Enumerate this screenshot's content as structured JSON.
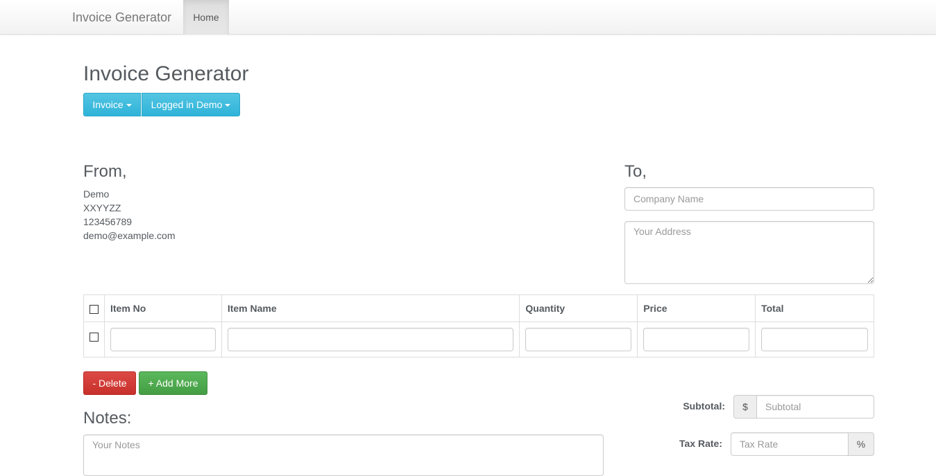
{
  "navbar": {
    "brand": "Invoice Generator",
    "home_label": "Home"
  },
  "page": {
    "title": "Invoice Generator"
  },
  "toolbar": {
    "invoice_label": "Invoice",
    "user_label": "Logged in Demo"
  },
  "from": {
    "heading": "From,",
    "name": "Demo",
    "address": "XXYYZZ",
    "phone": "123456789",
    "email": "demo@example.com"
  },
  "to": {
    "heading": "To,",
    "company_placeholder": "Company Name",
    "address_placeholder": "Your Address"
  },
  "items_table": {
    "columns": [
      "Item No",
      "Item Name",
      "Quantity",
      "Price",
      "Total"
    ]
  },
  "actions": {
    "delete_label": "- Delete",
    "add_more_label": "+ Add More"
  },
  "notes": {
    "heading": "Notes:",
    "placeholder": "Your Notes"
  },
  "totals": {
    "subtotal_label": "Subtotal:",
    "currency_symbol": "$",
    "subtotal_placeholder": "Subtotal",
    "tax_rate_label": "Tax Rate:",
    "tax_rate_placeholder": "Tax Rate",
    "percent_symbol": "%"
  }
}
